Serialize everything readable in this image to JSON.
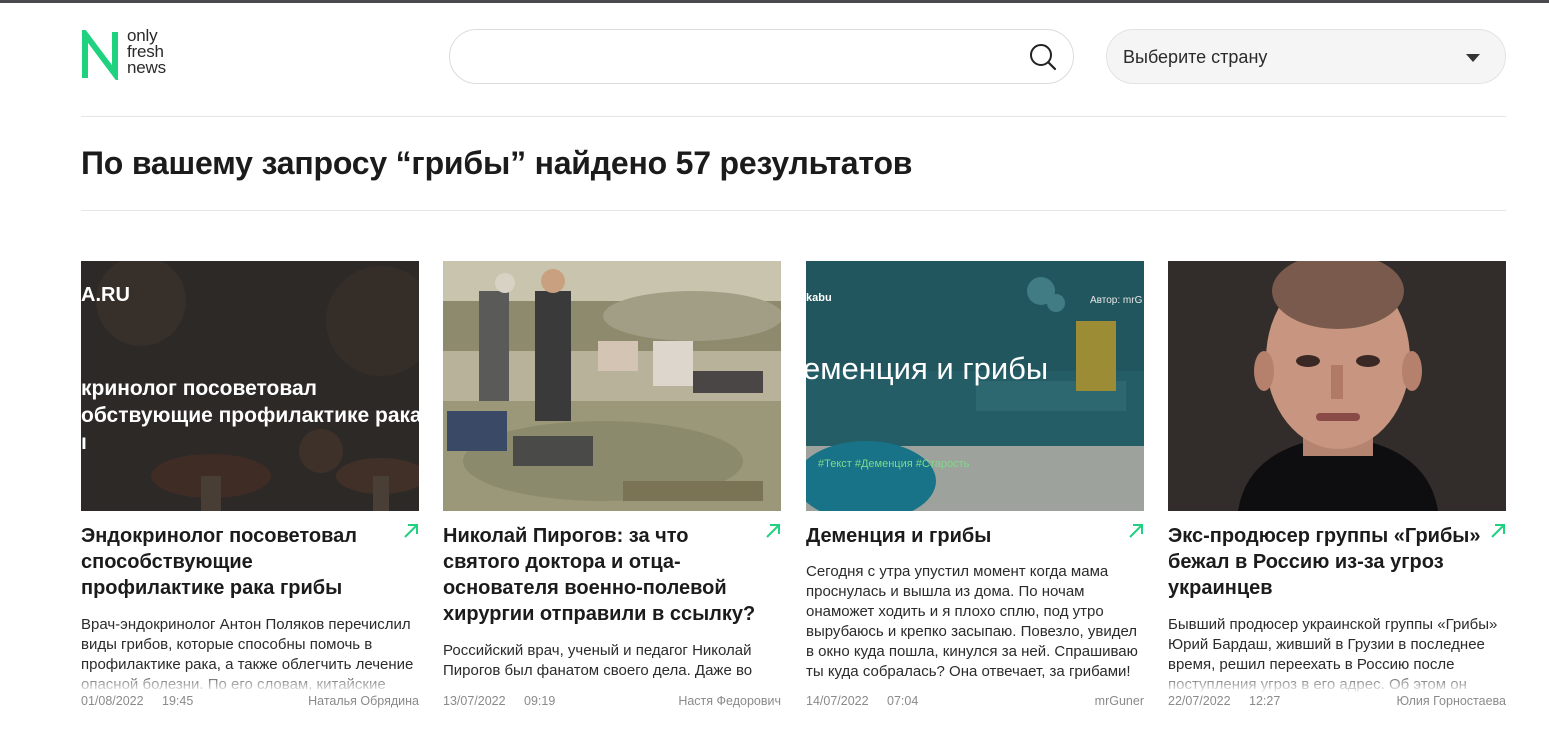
{
  "logo": {
    "letter": "N",
    "line1": "only",
    "line2": "fresh",
    "line3": "news"
  },
  "search": {
    "value": "",
    "placeholder": ""
  },
  "country": {
    "label": "Выберите страну"
  },
  "results_heading": "По вашему запросу “грибы” найдено 57 результатов",
  "colors": {
    "accent": "#1fd27f",
    "text": "#1b1b1b",
    "meta": "#8a8a8a"
  },
  "cards": [
    {
      "image": {
        "overlay_site": "A.RU",
        "overlay_line1": "кринолог посоветовал",
        "overlay_line2": "обствующие профилактике рака",
        "overlay_line3": "ı"
      },
      "title": "Эндокринолог посоветовал способствующие профилактике рака грибы",
      "description": "Врач-эндокринолог Антон Поляков перечислил виды грибов, которые способны помочь в профилактике рака, а также облегчить лечение опасной болезни. По его словам, китайские",
      "date": "01/08/2022",
      "time": "19:45",
      "author": "Наталья Обрядина"
    },
    {
      "image": {},
      "title": "Николай Пирогов: за что святого доктора и отца-основателя военно-полевой хирургии отправили в ссылку?",
      "description": "Российский врач, ученый и педагог Николай Пирогов был фанатом своего дела. Даже во",
      "date": "13/07/2022",
      "time": "09:19",
      "author": "Настя Федорович"
    },
    {
      "image": {
        "overlay_site": "kabu",
        "overlay_author": "Автор: mrG",
        "overlay_title": "еменция и грибы",
        "overlay_tags": "#Текст   #Деменция   #Старость"
      },
      "title": "Деменция и грибы",
      "description": "Сегодня с утра упустил момент когда мама проснулась и вышла из дома. По ночам онаможет ходить и я плохо сплю, под утро вырубаюсь и крепко засыпаю. Повезло, увидел в окно куда пошла, кинулся за ней. Спрашиваю ты куда собралась? Она отвечает, за грибами!",
      "date": "14/07/2022",
      "time": "07:04",
      "author": "mrGuner"
    },
    {
      "image": {},
      "title": "Экс-продюсер группы «Грибы» бежал в Россию из-за угроз украинцев",
      "description": "Бывший продюсер украинской группы «Грибы» Юрий Бардаш, живший в Грузии в последнее время, решил переехать в Россию после поступления угроз в его адрес. Об этом он",
      "date": "22/07/2022",
      "time": "12:27",
      "author": "Юлия Горностаева"
    }
  ]
}
